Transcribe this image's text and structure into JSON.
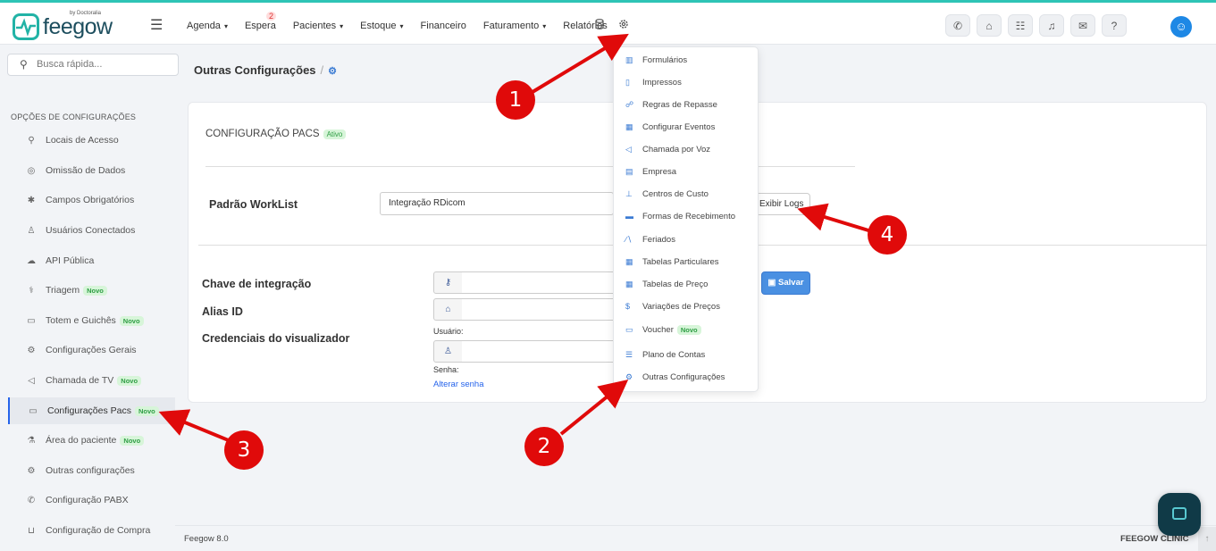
{
  "header": {
    "brand": "feegow",
    "brand_sub": "by Doctoralia",
    "nav": [
      {
        "label": "Agenda",
        "caret": "▾"
      },
      {
        "label": "Espera",
        "badge": "2"
      },
      {
        "label": "Pacientes",
        "caret": "▾"
      },
      {
        "label": "Estoque",
        "caret": "▾"
      },
      {
        "label": "Financeiro"
      },
      {
        "label": "Faturamento",
        "caret": "▾"
      },
      {
        "label": "Relatórios"
      }
    ],
    "icons": [
      "phone-icon",
      "inbox-icon",
      "checklist-icon",
      "bell-icon",
      "chat-icon",
      "help-icon"
    ]
  },
  "search": {
    "placeholder": "Busca rápida..."
  },
  "sidebar": {
    "heading": "OPÇÕES DE CONFIGURAÇÕES",
    "items": [
      {
        "label": "Locais de Acesso",
        "icon": "user-pin-icon"
      },
      {
        "label": "Omissão de Dados",
        "icon": "eye-off-icon"
      },
      {
        "label": "Campos Obrigatórios",
        "icon": "asterisk-icon"
      },
      {
        "label": "Usuários Conectados",
        "icon": "user-icon"
      },
      {
        "label": "API Pública",
        "icon": "cloud-icon"
      },
      {
        "label": "Triagem",
        "icon": "stethoscope-icon",
        "badge": "Novo"
      },
      {
        "label": "Totem e Guichês",
        "icon": "monitor-icon",
        "badge": "Novo"
      },
      {
        "label": "Configurações Gerais",
        "icon": "gears-icon"
      },
      {
        "label": "Chamada de TV",
        "icon": "megaphone-icon",
        "badge": "Novo"
      },
      {
        "label": "Configurações Pacs",
        "icon": "laptop-icon",
        "badge": "Novo"
      },
      {
        "label": "Área do paciente",
        "icon": "flask-icon",
        "badge": "Novo"
      },
      {
        "label": "Outras configurações",
        "icon": "gears-icon"
      },
      {
        "label": "Configuração PABX",
        "icon": "phone-icon"
      },
      {
        "label": "Configuração de Compra",
        "icon": "cart-icon"
      }
    ]
  },
  "breadcrumb": {
    "title": "Outras Configurações",
    "sep": "/"
  },
  "pacs": {
    "title": "CONFIGURAÇÃO PACS",
    "status": "Ativo",
    "worklist_label": "Padrão WorkList",
    "worklist_value": "Integração RDicom",
    "logs_button": "Exibir Logs",
    "key_label": "Chave de integração",
    "alias_label": "Alias ID",
    "creds_label": "Credenciais do visualizador",
    "user_label": "Usuário:",
    "password_label": "Senha:",
    "change_password": "Alterar senha",
    "save_button": "Salvar"
  },
  "dropdown": {
    "items": [
      {
        "label": "Formulários",
        "icon": "chart-icon"
      },
      {
        "label": "Impressos",
        "icon": "file-icon"
      },
      {
        "label": "Regras de Repasse",
        "icon": "handshake-icon"
      },
      {
        "label": "Configurar Eventos",
        "icon": "calendar-icon"
      },
      {
        "label": "Chamada por Voz",
        "icon": "volume-icon"
      },
      {
        "label": "Empresa",
        "icon": "building-icon"
      },
      {
        "label": "Centros de Custo",
        "icon": "sitemap-icon"
      },
      {
        "label": "Formas de Recebimento",
        "icon": "credit-card-icon"
      },
      {
        "label": "Feriados",
        "icon": "road-icon"
      },
      {
        "label": "Tabelas Particulares",
        "icon": "table-icon"
      },
      {
        "label": "Tabelas de Preço",
        "icon": "table-icon"
      },
      {
        "label": "Variações de Preços",
        "icon": "dollar-icon"
      },
      {
        "label": "Voucher",
        "icon": "ticket-icon",
        "badge": "Novo"
      },
      {
        "label": "Plano de Contas",
        "icon": "list-icon"
      },
      {
        "label": "Outras Configurações",
        "icon": "gears-icon"
      }
    ]
  },
  "markers": [
    "1",
    "2",
    "3",
    "4"
  ],
  "footer": {
    "left": "Feegow 8.0",
    "right": "FEEGOW CLINIC"
  },
  "colors": {
    "accent": "#2ec4b6",
    "primary": "#2563eb",
    "marker": "#e00a0a",
    "novo_bg": "#d7f5d9"
  }
}
